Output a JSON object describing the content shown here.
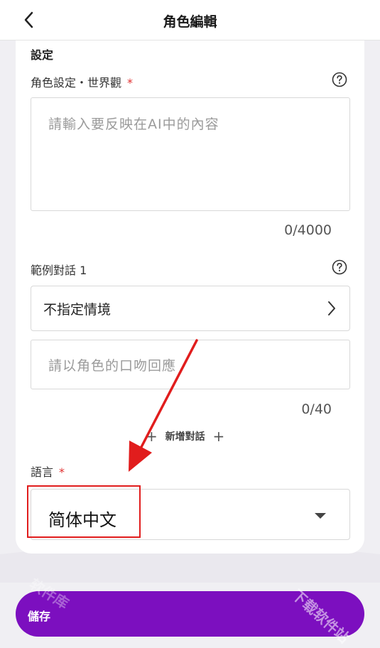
{
  "header": {
    "title": "角色編輯"
  },
  "settings": {
    "section_title": "設定",
    "worldview": {
      "label": "角色設定・世界觀",
      "required_mark": "*",
      "placeholder": "請輸入要反映在AI中的內容",
      "counter": "0/4000"
    },
    "example_dialog": {
      "label": "範例對話 1",
      "scenario": "不指定情境",
      "reply_placeholder": "請以角色的口吻回應",
      "counter": "0/40",
      "add_label": "新增對話"
    },
    "language": {
      "label": "語言",
      "required_mark": "*",
      "value": "简体中文"
    }
  },
  "footer": {
    "save_label": "儲存"
  },
  "watermark": {
    "left": "软件库",
    "right": "下载软件站"
  },
  "colors": {
    "accent": "#7c0fbf",
    "required": "#e03030",
    "annotation": "#e11d1d"
  }
}
